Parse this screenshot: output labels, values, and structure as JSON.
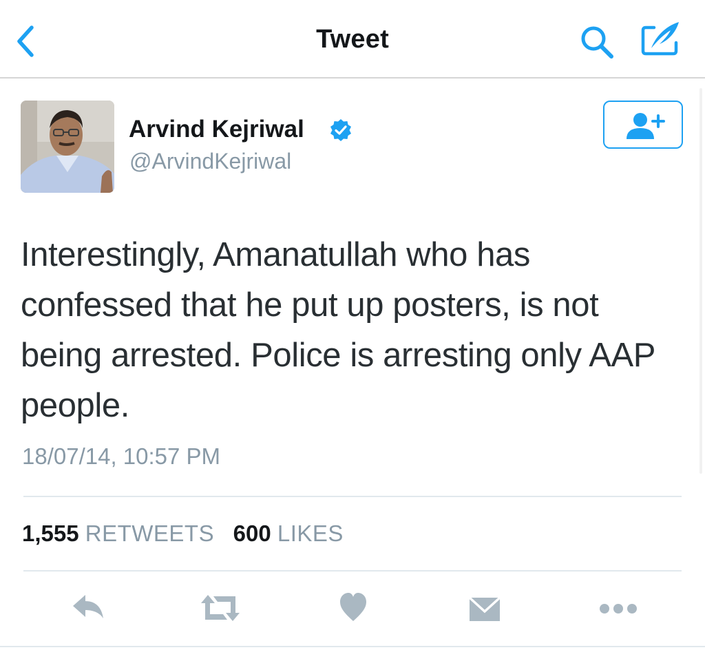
{
  "navbar": {
    "title": "Tweet",
    "back_icon": "chevron-left-icon",
    "search_icon": "search-icon",
    "compose_icon": "compose-tweet-icon"
  },
  "author": {
    "display_name": "Arvind Kejriwal",
    "handle": "@ArvindKejriwal",
    "verified": true,
    "follow_icon": "add-user-icon"
  },
  "tweet": {
    "text": "Interestingly, Amanatullah who has confessed that he put up posters, is not being arrested. Police is arresting only AAP people.",
    "timestamp": "18/07/14, 10:57 PM"
  },
  "stats": {
    "retweets_count": "1,555",
    "retweets_label": "RETWEETS",
    "likes_count": "600",
    "likes_label": "LIKES"
  },
  "actions": [
    {
      "name": "reply",
      "icon": "reply-icon"
    },
    {
      "name": "retweet",
      "icon": "retweet-icon"
    },
    {
      "name": "like",
      "icon": "heart-icon"
    },
    {
      "name": "direct-message",
      "icon": "envelope-icon"
    },
    {
      "name": "more",
      "icon": "more-icon"
    }
  ],
  "colors": {
    "accent": "#1DA1F2",
    "text_primary": "#14171A",
    "text_secondary": "#8899A6",
    "icon_gray": "#AAB8C2"
  }
}
